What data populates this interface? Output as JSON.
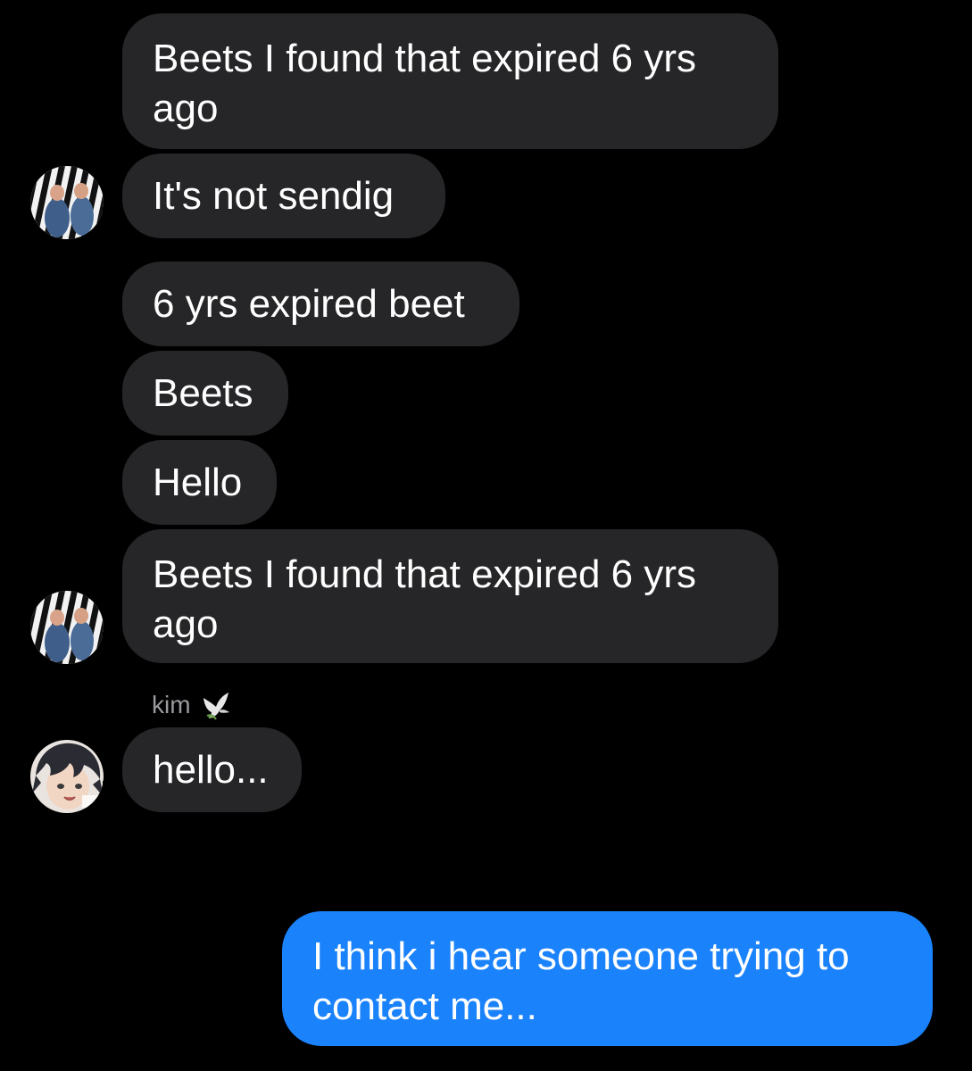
{
  "messages": [
    {
      "text": "Beets I found that expired 6 yrs\nago",
      "from": "other"
    },
    {
      "text": "It's not sendig",
      "from": "other"
    },
    {
      "text": "6 yrs expired beet",
      "from": "other"
    },
    {
      "text": "Beets",
      "from": "other"
    },
    {
      "text": "Hello",
      "from": "other"
    },
    {
      "text": "Beets I found that expired 6 yrs\nago",
      "from": "other"
    },
    {
      "text": "hello...",
      "from": "kim"
    },
    {
      "text": "I think i hear someone trying to\ncontact me...",
      "from": "me"
    }
  ],
  "sender": {
    "name": "kim",
    "emoji_icon": "dove-icon"
  },
  "colors": {
    "background": "#000000",
    "incoming_bubble": "#262628",
    "outgoing_bubble": "#1a82fb",
    "sender_name": "#9a9a9f"
  }
}
